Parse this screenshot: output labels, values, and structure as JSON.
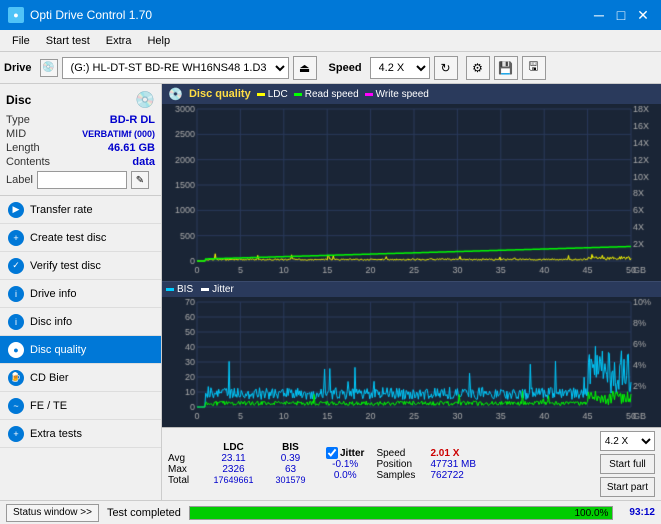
{
  "titlebar": {
    "title": "Opti Drive Control 1.70",
    "icon": "●",
    "minimize": "─",
    "maximize": "□",
    "close": "✕"
  },
  "menubar": {
    "items": [
      "File",
      "Start test",
      "Extra",
      "Help"
    ]
  },
  "toolbar": {
    "drive_label": "Drive",
    "drive_value": "(G:) HL-DT-ST BD-RE  WH16NS48 1.D3",
    "speed_label": "Speed",
    "speed_value": "4.2 X"
  },
  "disc": {
    "title": "Disc",
    "type_label": "Type",
    "type_value": "BD-R DL",
    "mid_label": "MID",
    "mid_value": "VERBATIMf (000)",
    "length_label": "Length",
    "length_value": "46.61 GB",
    "contents_label": "Contents",
    "contents_value": "data",
    "label_label": "Label",
    "label_placeholder": ""
  },
  "nav": {
    "items": [
      {
        "id": "transfer-rate",
        "label": "Transfer rate",
        "active": false
      },
      {
        "id": "create-test-disc",
        "label": "Create test disc",
        "active": false
      },
      {
        "id": "verify-test-disc",
        "label": "Verify test disc",
        "active": false
      },
      {
        "id": "drive-info",
        "label": "Drive info",
        "active": false
      },
      {
        "id": "disc-info",
        "label": "Disc info",
        "active": false
      },
      {
        "id": "disc-quality",
        "label": "Disc quality",
        "active": true
      },
      {
        "id": "cd-bier",
        "label": "CD Bier",
        "active": false
      },
      {
        "id": "fe-te",
        "label": "FE / TE",
        "active": false
      },
      {
        "id": "extra-tests",
        "label": "Extra tests",
        "active": false
      }
    ]
  },
  "chart": {
    "title": "Disc quality",
    "legend": [
      {
        "label": "LDC",
        "color": "#ffff00"
      },
      {
        "label": "Read speed",
        "color": "#00ff00"
      },
      {
        "label": "Write speed",
        "color": "#ff00ff"
      }
    ],
    "top_y_left_max": 3000,
    "top_y_right_max": "18X",
    "bottom_legend": [
      {
        "label": "BIS",
        "color": "#00ccff"
      },
      {
        "label": "Jitter",
        "color": "#ffffff"
      }
    ],
    "bottom_y_left_max": 70,
    "bottom_y_right_max": "10%"
  },
  "stats": {
    "headers": [
      "",
      "LDC",
      "BIS",
      "",
      "Jitter",
      "Speed",
      ""
    ],
    "avg_label": "Avg",
    "avg_ldc": "23.11",
    "avg_bis": "0.39",
    "avg_jitter": "-0.1%",
    "max_label": "Max",
    "max_ldc": "2326",
    "max_bis": "63",
    "max_jitter": "0.0%",
    "total_label": "Total",
    "total_ldc": "17649661",
    "total_bis": "301579",
    "speed_label": "Speed",
    "speed_value": "2.01 X",
    "position_label": "Position",
    "position_value": "47731 MB",
    "samples_label": "Samples",
    "samples_value": "762722",
    "speed_dropdown": "4.2 X",
    "start_full": "Start full",
    "start_part": "Start part"
  },
  "statusbar": {
    "status_window": "Status window >>",
    "status_text": "Test completed",
    "progress": 100.0,
    "time": "93:12"
  },
  "colors": {
    "accent": "#0078d7",
    "chart_bg": "#1a2536",
    "grid": "#2a3a5c",
    "ldc": "#ffff00",
    "read_speed": "#00ff00",
    "bis": "#00ccff",
    "jitter": "#ffffff",
    "active_nav": "#0078d7"
  }
}
